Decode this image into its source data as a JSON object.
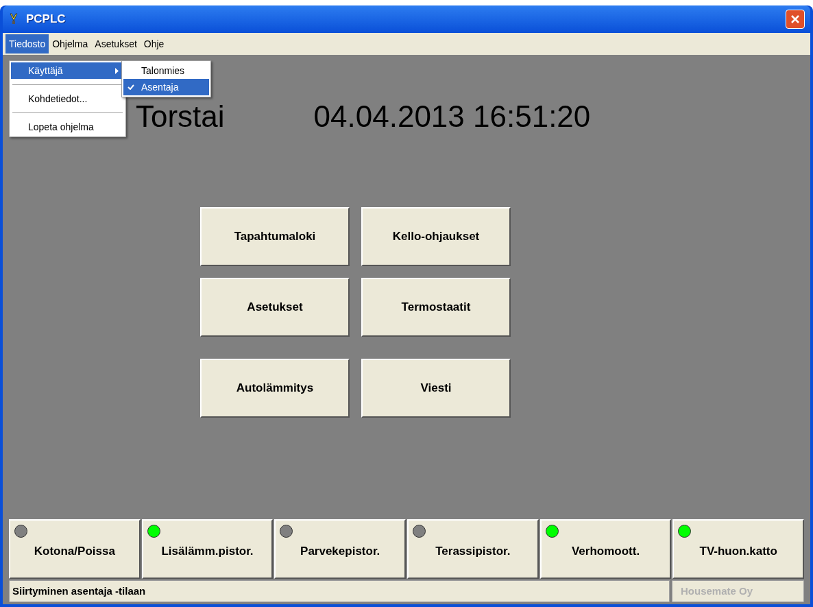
{
  "window": {
    "title": "PCPLC"
  },
  "menu_bar": [
    {
      "label": "Tiedosto",
      "selected": true
    },
    {
      "label": "Ohjelma",
      "selected": false
    },
    {
      "label": "Asetukset",
      "selected": false
    },
    {
      "label": "Ohje",
      "selected": false
    }
  ],
  "dropdown": [
    {
      "kind": "submenu",
      "label": "Käyttäjä",
      "selected": true
    },
    {
      "kind": "separator"
    },
    {
      "kind": "item",
      "label": "Kohdetiedot...",
      "selected": false
    },
    {
      "kind": "separator"
    },
    {
      "kind": "item",
      "label": "Lopeta ohjelma",
      "selected": false
    }
  ],
  "submenu": [
    {
      "label": "Talonmies",
      "checked": false,
      "selected": false
    },
    {
      "label": "Asentaja",
      "checked": true,
      "selected": true
    }
  ],
  "day": "Torstai",
  "datetime": "04.04.2013 16:51:20",
  "buttons": [
    [
      "Tapahtumaloki",
      "Kello-ohjaukset"
    ],
    [
      "Asetukset",
      "Termostaatit"
    ],
    [
      "Autolämmitys",
      "Viesti"
    ]
  ],
  "switches": [
    {
      "label": "Kotona/Poissa",
      "color": "#808080"
    },
    {
      "label": "Lisälämm.pistor.",
      "color": "#00ff00"
    },
    {
      "label": "Parvekepistor.",
      "color": "#808080"
    },
    {
      "label": "Terassipistor.",
      "color": "#808080"
    },
    {
      "label": "Verhomoott.",
      "color": "#00ff00"
    },
    {
      "label": "TV-huon.katto",
      "color": "#00ff00"
    }
  ],
  "status_bar": {
    "message": "Siirtyminen asentaja -tilaan",
    "company": "Housemate Oy"
  }
}
